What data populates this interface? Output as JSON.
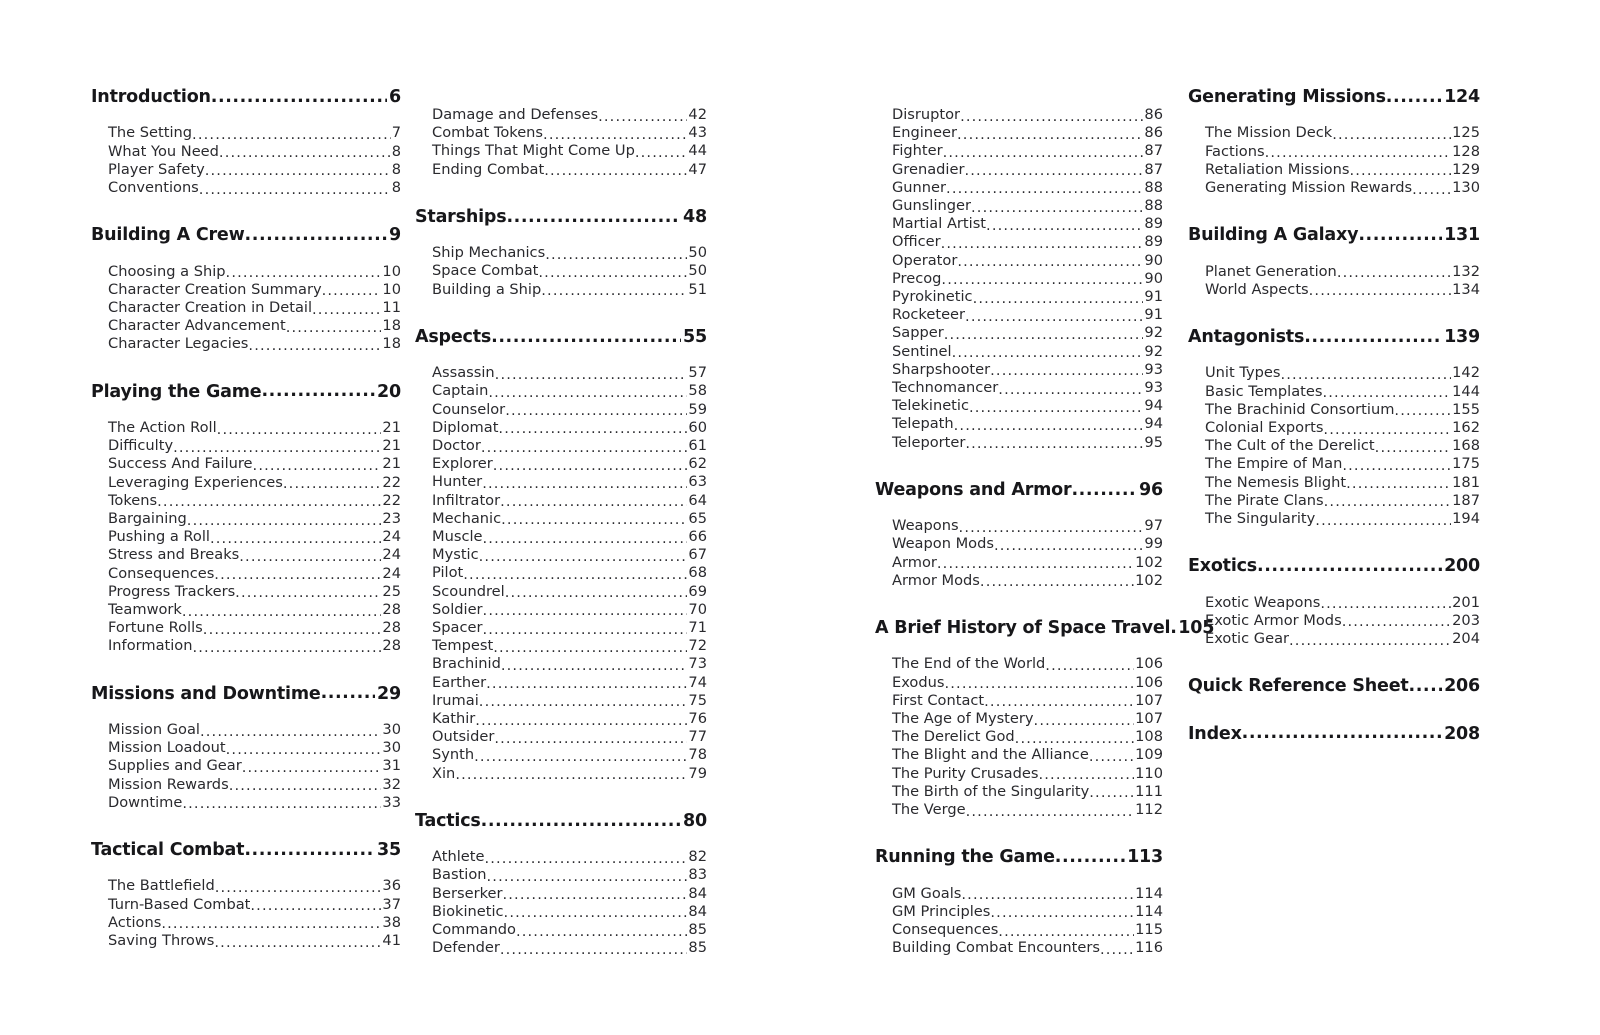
{
  "document": {
    "kind": "table-of-contents",
    "text_color": "#231f20",
    "background_color": "#ffffff"
  },
  "columns": [
    {
      "id": "column-1",
      "blocks": [
        {
          "type": "chapter",
          "title": "Introduction",
          "page": "6",
          "entries": [
            {
              "title": "The Setting",
              "page": "7"
            },
            {
              "title": "What You Need",
              "page": "8"
            },
            {
              "title": "Player Safety",
              "page": "8"
            },
            {
              "title": "Conventions",
              "page": "8"
            }
          ]
        },
        {
          "type": "chapter",
          "title": "Building A Crew",
          "page": "9",
          "entries": [
            {
              "title": "Choosing a Ship",
              "page": "10"
            },
            {
              "title": "Character Creation Summary",
              "page": "10"
            },
            {
              "title": "Character Creation in Detail",
              "page": "11"
            },
            {
              "title": "Character Advancement",
              "page": "18"
            },
            {
              "title": "Character Legacies",
              "page": "18"
            }
          ]
        },
        {
          "type": "chapter",
          "title": "Playing the Game",
          "page": "20",
          "entries": [
            {
              "title": "The Action Roll",
              "page": "21"
            },
            {
              "title": "Difficulty",
              "page": "21"
            },
            {
              "title": "Success And Failure",
              "page": "21"
            },
            {
              "title": "Leveraging Experiences",
              "page": "22"
            },
            {
              "title": "Tokens",
              "page": "22"
            },
            {
              "title": "Bargaining",
              "page": "23"
            },
            {
              "title": "Pushing a Roll",
              "page": "24"
            },
            {
              "title": "Stress and Breaks",
              "page": "24"
            },
            {
              "title": "Consequences",
              "page": "24"
            },
            {
              "title": "Progress Trackers",
              "page": "25"
            },
            {
              "title": "Teamwork",
              "page": "28"
            },
            {
              "title": "Fortune Rolls",
              "page": "28"
            },
            {
              "title": "Information",
              "page": "28"
            }
          ]
        },
        {
          "type": "chapter",
          "title": "Missions and Downtime",
          "page": "29",
          "entries": [
            {
              "title": "Mission Goal",
              "page": "30"
            },
            {
              "title": "Mission Loadout",
              "page": "30"
            },
            {
              "title": "Supplies and Gear",
              "page": "31"
            },
            {
              "title": "Mission Rewards",
              "page": "32"
            },
            {
              "title": "Downtime",
              "page": "33"
            }
          ]
        },
        {
          "type": "chapter",
          "title": "Tactical Combat",
          "page": "35",
          "entries": [
            {
              "title": "The Battlefield",
              "page": "36"
            },
            {
              "title": "Turn-Based Combat",
              "page": "37"
            },
            {
              "title": "Actions",
              "page": "38"
            },
            {
              "title": "Saving Throws",
              "page": "41"
            }
          ]
        }
      ]
    },
    {
      "id": "column-2",
      "blocks": [
        {
          "type": "continuation",
          "title": "",
          "page": "",
          "entries": [
            {
              "title": "Damage and Defenses",
              "page": "42"
            },
            {
              "title": "Combat Tokens",
              "page": "43"
            },
            {
              "title": "Things That Might Come Up",
              "page": "44"
            },
            {
              "title": "Ending Combat",
              "page": "47"
            }
          ]
        },
        {
          "type": "chapter",
          "title": "Starships",
          "page": "48",
          "entries": [
            {
              "title": "Ship Mechanics",
              "page": "50"
            },
            {
              "title": "Space Combat",
              "page": "50"
            },
            {
              "title": "Building a Ship",
              "page": "51"
            }
          ]
        },
        {
          "type": "chapter",
          "title": "Aspects",
          "page": "55",
          "entries": [
            {
              "title": "Assassin",
              "page": "57"
            },
            {
              "title": "Captain",
              "page": "58"
            },
            {
              "title": "Counselor",
              "page": "59"
            },
            {
              "title": "Diplomat",
              "page": "60"
            },
            {
              "title": "Doctor",
              "page": "61"
            },
            {
              "title": "Explorer",
              "page": "62"
            },
            {
              "title": "Hunter",
              "page": "63"
            },
            {
              "title": "Infiltrator",
              "page": "64"
            },
            {
              "title": "Mechanic",
              "page": "65"
            },
            {
              "title": "Muscle",
              "page": "66"
            },
            {
              "title": "Mystic",
              "page": "67"
            },
            {
              "title": "Pilot",
              "page": "68"
            },
            {
              "title": "Scoundrel",
              "page": "69"
            },
            {
              "title": "Soldier",
              "page": "70"
            },
            {
              "title": "Spacer",
              "page": "71"
            },
            {
              "title": "Tempest",
              "page": "72"
            },
            {
              "title": "Brachinid",
              "page": "73"
            },
            {
              "title": "Earther",
              "page": "74"
            },
            {
              "title": "Irumai",
              "page": "75"
            },
            {
              "title": "Kathir",
              "page": "76"
            },
            {
              "title": "Outsider",
              "page": "77"
            },
            {
              "title": "Synth",
              "page": "78"
            },
            {
              "title": "Xin",
              "page": "79"
            }
          ]
        },
        {
          "type": "chapter",
          "title": "Tactics",
          "page": "80",
          "entries": [
            {
              "title": "Athlete",
              "page": "82"
            },
            {
              "title": "Bastion",
              "page": "83"
            },
            {
              "title": "Berserker",
              "page": "84"
            },
            {
              "title": "Biokinetic",
              "page": "84"
            },
            {
              "title": "Commando",
              "page": "85"
            },
            {
              "title": "Defender",
              "page": "85"
            }
          ]
        }
      ]
    },
    {
      "id": "column-3",
      "blocks": [
        {
          "type": "continuation",
          "title": "",
          "page": "",
          "entries": [
            {
              "title": "Disruptor",
              "page": "86"
            },
            {
              "title": "Engineer",
              "page": "86"
            },
            {
              "title": "Fighter",
              "page": "87"
            },
            {
              "title": "Grenadier",
              "page": "87"
            },
            {
              "title": "Gunner",
              "page": "88"
            },
            {
              "title": "Gunslinger",
              "page": "88"
            },
            {
              "title": "Martial Artist",
              "page": "89"
            },
            {
              "title": "Officer",
              "page": "89"
            },
            {
              "title": "Operator",
              "page": "90"
            },
            {
              "title": "Precog",
              "page": "90"
            },
            {
              "title": "Pyrokinetic",
              "page": "91"
            },
            {
              "title": "Rocketeer",
              "page": "91"
            },
            {
              "title": "Sapper",
              "page": "92"
            },
            {
              "title": "Sentinel",
              "page": "92"
            },
            {
              "title": "Sharpshooter",
              "page": "93"
            },
            {
              "title": "Technomancer",
              "page": "93"
            },
            {
              "title": "Telekinetic",
              "page": "94"
            },
            {
              "title": "Telepath",
              "page": "94"
            },
            {
              "title": "Teleporter",
              "page": "95"
            }
          ]
        },
        {
          "type": "chapter",
          "title": "Weapons and Armor",
          "page": "96",
          "entries": [
            {
              "title": "Weapons",
              "page": "97"
            },
            {
              "title": "Weapon Mods",
              "page": "99"
            },
            {
              "title": "Armor",
              "page": "102"
            },
            {
              "title": "Armor Mods",
              "page": "102"
            }
          ]
        },
        {
          "type": "chapter",
          "title": "A Brief History of Space Travel",
          "page": "105",
          "entries": [
            {
              "title": "The End of the World",
              "page": "106"
            },
            {
              "title": "Exodus",
              "page": "106"
            },
            {
              "title": "First Contact",
              "page": "107"
            },
            {
              "title": "The Age of Mystery",
              "page": "107"
            },
            {
              "title": "The Derelict God",
              "page": "108"
            },
            {
              "title": "The Blight and the Alliance",
              "page": "109"
            },
            {
              "title": "The Purity Crusades",
              "page": "110"
            },
            {
              "title": "The Birth of the Singularity",
              "page": "111"
            },
            {
              "title": "The Verge",
              "page": "112"
            }
          ]
        },
        {
          "type": "chapter",
          "title": "Running the Game",
          "page": "113",
          "entries": [
            {
              "title": "GM Goals",
              "page": "114"
            },
            {
              "title": "GM Principles",
              "page": "114"
            },
            {
              "title": "Consequences",
              "page": "115"
            },
            {
              "title": "Building Combat Encounters",
              "page": "116"
            }
          ]
        }
      ]
    },
    {
      "id": "column-4",
      "blocks": [
        {
          "type": "chapter",
          "title": "Generating Missions",
          "page": "124",
          "entries": [
            {
              "title": "The Mission Deck",
              "page": "125"
            },
            {
              "title": "Factions",
              "page": "128"
            },
            {
              "title": "Retaliation Missions",
              "page": "129"
            },
            {
              "title": "Generating Mission Rewards",
              "page": "130"
            }
          ]
        },
        {
          "type": "chapter",
          "title": "Building A Galaxy",
          "page": "131",
          "entries": [
            {
              "title": "Planet Generation",
              "page": "132"
            },
            {
              "title": "World Aspects",
              "page": "134"
            }
          ]
        },
        {
          "type": "chapter",
          "title": "Antagonists",
          "page": "139",
          "entries": [
            {
              "title": "Unit Types",
              "page": "142"
            },
            {
              "title": "Basic Templates",
              "page": "144"
            },
            {
              "title": "The Brachinid Consortium",
              "page": "155"
            },
            {
              "title": "Colonial Exports",
              "page": "162"
            },
            {
              "title": "The Cult of the Derelict",
              "page": "168"
            },
            {
              "title": "The Empire of Man",
              "page": "175"
            },
            {
              "title": "The Nemesis Blight",
              "page": "181"
            },
            {
              "title": "The Pirate Clans",
              "page": "187"
            },
            {
              "title": "The Singularity",
              "page": "194"
            }
          ]
        },
        {
          "type": "chapter",
          "title": "Exotics",
          "page": "200",
          "entries": [
            {
              "title": "Exotic Weapons",
              "page": "201"
            },
            {
              "title": "Exotic Armor Mods",
              "page": "203"
            },
            {
              "title": "Exotic Gear",
              "page": "204"
            }
          ]
        },
        {
          "type": "chapter",
          "title": "Quick Reference Sheet",
          "page": "206",
          "entries": []
        },
        {
          "type": "chapter",
          "title": "Index",
          "page": "208",
          "entries": []
        }
      ]
    }
  ]
}
